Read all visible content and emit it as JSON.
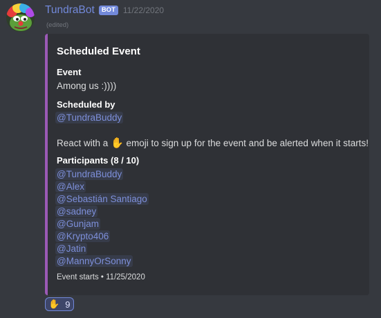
{
  "message": {
    "author": "TundraBot",
    "bot_tag": "BOT",
    "timestamp": "11/22/2020",
    "edited_label": "(edited)"
  },
  "embed": {
    "accent_color": "#9b59b6",
    "title": "Scheduled Event",
    "event_label": "Event",
    "event_value": "Among us :))))",
    "scheduled_by_label": "Scheduled by",
    "scheduled_by_value": "@TundraBuddy",
    "description_before": "React with a",
    "description_emoji": "raised-hand-emoji",
    "description_after": "emoji to sign up for the event and be alerted when it starts!",
    "participants_label": "Participants (8 / 10)",
    "participants": [
      "@TundraBuddy",
      "@Alex",
      "@Sebastián Santiago",
      "@sadney",
      "@Gunjam",
      "@Krypto406",
      "@Jatin",
      "@MannyOrSonny"
    ],
    "footer": "Event starts • 11/25/2020"
  },
  "reaction": {
    "emoji": "raised-hand-emoji",
    "count": "9"
  },
  "colors": {
    "background": "#36393f",
    "embed_background": "#2f3136",
    "mention": "#7d8fda",
    "username": "#7289da"
  }
}
